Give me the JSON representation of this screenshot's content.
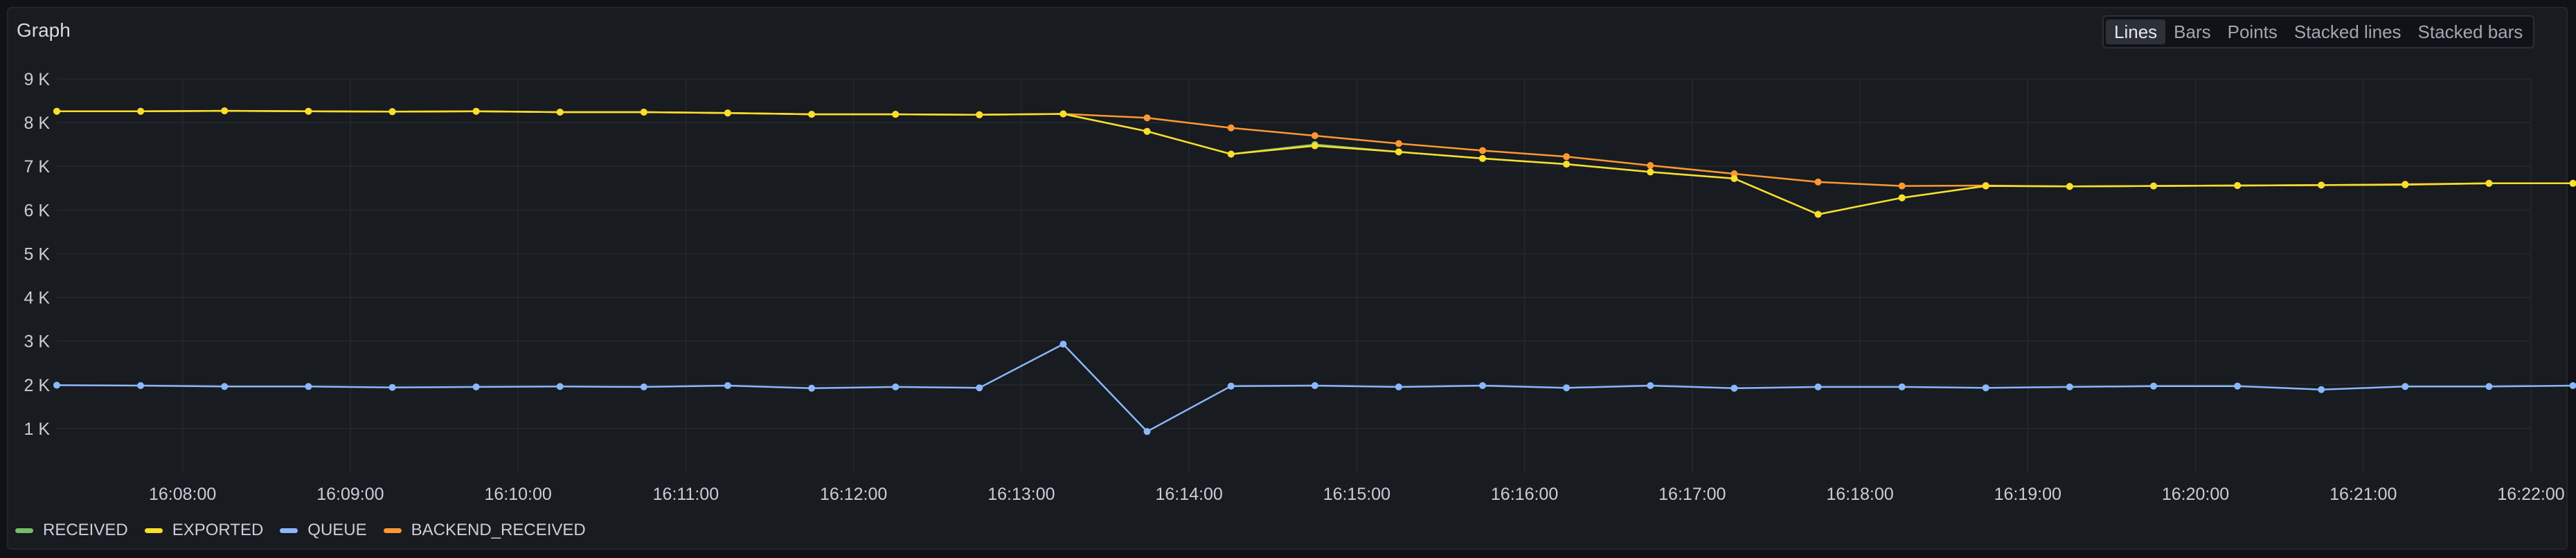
{
  "panel": {
    "title": "Graph",
    "view_modes": [
      "Lines",
      "Bars",
      "Points",
      "Stacked lines",
      "Stacked bars"
    ],
    "active_view_mode": "Lines"
  },
  "colors": {
    "background": "#111217",
    "panel": "#181b1f",
    "grid": "#25282e",
    "text": "#ccccdc"
  },
  "chart_data": {
    "type": "line",
    "x_start": "16:07:15",
    "x_step_seconds": 30,
    "xlim": [
      "16:07:15",
      "16:22:00"
    ],
    "ylim": [
      0,
      9000
    ],
    "yticks": [
      1000,
      2000,
      3000,
      4000,
      5000,
      6000,
      7000,
      8000,
      9000
    ],
    "ytick_labels": [
      "1 K",
      "2 K",
      "3 K",
      "4 K",
      "5 K",
      "6 K",
      "7 K",
      "8 K",
      "9 K"
    ],
    "xticks": [
      "16:08:00",
      "16:09:00",
      "16:10:00",
      "16:11:00",
      "16:12:00",
      "16:13:00",
      "16:14:00",
      "16:15:00",
      "16:16:00",
      "16:17:00",
      "16:18:00",
      "16:19:00",
      "16:20:00",
      "16:21:00",
      "16:22:00"
    ],
    "grid": true,
    "legend_position": "bottom-left",
    "series": [
      {
        "name": "RECEIVED",
        "color": "#73bf69",
        "values": [
          8260,
          8260,
          8270,
          8260,
          8250,
          8260,
          8240,
          8240,
          8220,
          8190,
          8190,
          8180,
          8200,
          7800,
          7280,
          7500,
          7330,
          7180,
          7050,
          6870,
          6720,
          5900,
          6280,
          6550,
          6540,
          6550,
          6560,
          6570,
          6580,
          6610,
          6610
        ]
      },
      {
        "name": "EXPORTED",
        "color": "#fade2a",
        "values": [
          8260,
          8260,
          8270,
          8260,
          8250,
          8260,
          8240,
          8240,
          8220,
          8190,
          8190,
          8180,
          8200,
          7800,
          7280,
          7470,
          7330,
          7180,
          7050,
          6870,
          6720,
          5900,
          6280,
          6550,
          6540,
          6550,
          6560,
          6570,
          6580,
          6610,
          6610
        ]
      },
      {
        "name": "QUEUE",
        "color": "#8ab8ff",
        "values": [
          1990,
          1980,
          1960,
          1960,
          1940,
          1950,
          1960,
          1950,
          1980,
          1920,
          1950,
          1930,
          2930,
          930,
          1970,
          1980,
          1950,
          1980,
          1930,
          1980,
          1920,
          1950,
          1950,
          1930,
          1950,
          1970,
          1970,
          1890,
          1960,
          1960,
          1980
        ]
      },
      {
        "name": "BACKEND_RECEIVED",
        "color": "#ff9830",
        "values": [
          8260,
          8260,
          8270,
          8260,
          8250,
          8260,
          8240,
          8240,
          8220,
          8190,
          8190,
          8180,
          8200,
          8110,
          7880,
          7700,
          7520,
          7360,
          7220,
          7020,
          6830,
          6640,
          6550,
          6560,
          6540,
          6550,
          6560,
          6570,
          6590,
          6610,
          6610
        ]
      }
    ]
  }
}
